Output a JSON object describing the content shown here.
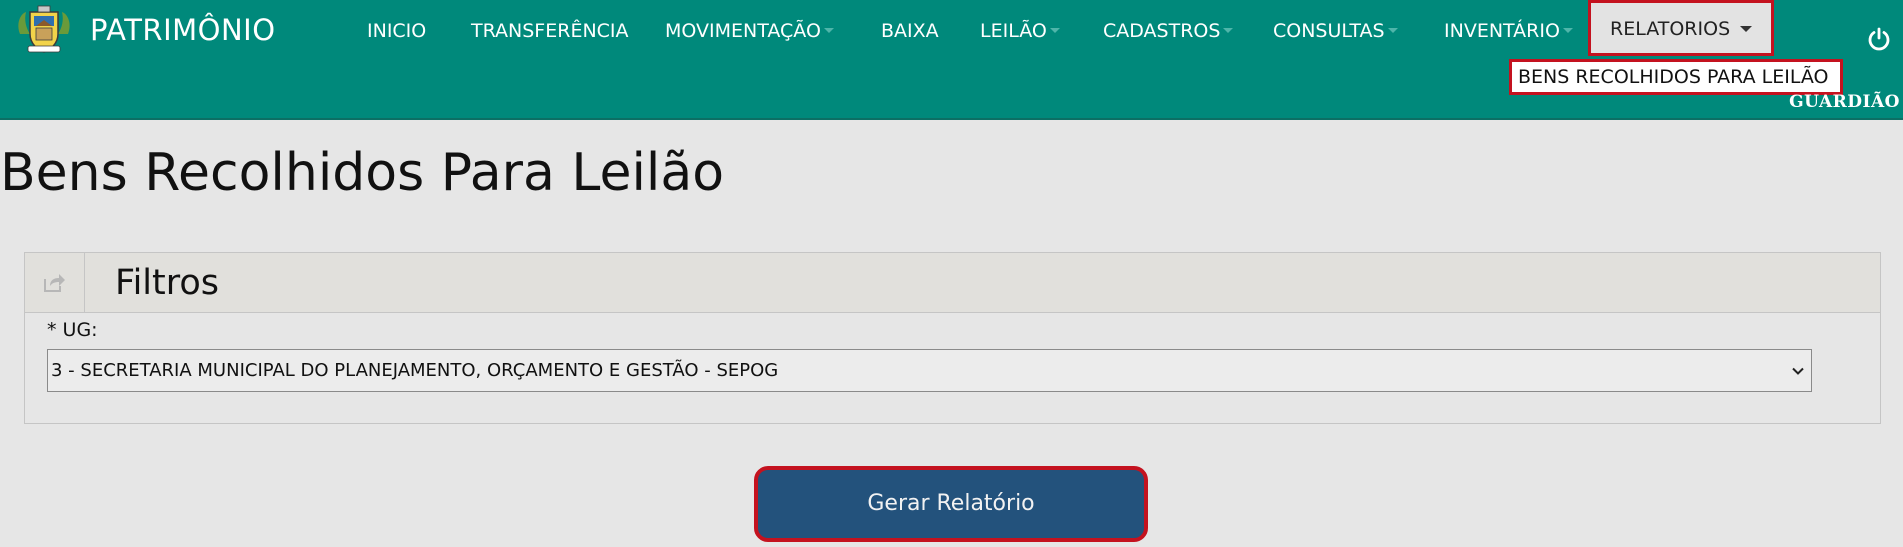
{
  "app": {
    "brand": "PATRIMÔNIO",
    "user": "GUARDIÃO"
  },
  "menu": [
    {
      "label": "INICIO",
      "caret": false
    },
    {
      "label": "TRANSFERÊNCIA",
      "caret": false
    },
    {
      "label": "MOVIMENTAÇÃO",
      "caret": true
    },
    {
      "label": "BAIXA",
      "caret": false
    },
    {
      "label": "LEILÃO",
      "caret": true
    },
    {
      "label": "CADASTROS",
      "caret": true
    },
    {
      "label": "CONSULTAS",
      "caret": true
    },
    {
      "label": "INVENTÁRIO",
      "caret": true
    },
    {
      "label": "RELATORIOS",
      "caret": true,
      "active": true
    }
  ],
  "dropdown": {
    "items": [
      "BENS RECOLHIDOS PARA LEILÃO"
    ]
  },
  "page": {
    "title": "Bens Recolhidos Para Leilão"
  },
  "filters": {
    "title": "Filtros",
    "ug_label": "* UG:",
    "ug_value": "3 - SECRETARIA MUNICIPAL DO PLANEJAMENTO, ORÇAMENTO E GESTÃO - SEPOG"
  },
  "actions": {
    "generate_label": "Gerar Relatório"
  },
  "colors": {
    "navbar": "#00897b",
    "button": "#23527c",
    "highlight": "#c4121f"
  },
  "icons": {
    "logo": "municipal-crest-logo",
    "power": "power-icon",
    "share": "share-icon",
    "select_arrow": "chevron-down-icon"
  }
}
